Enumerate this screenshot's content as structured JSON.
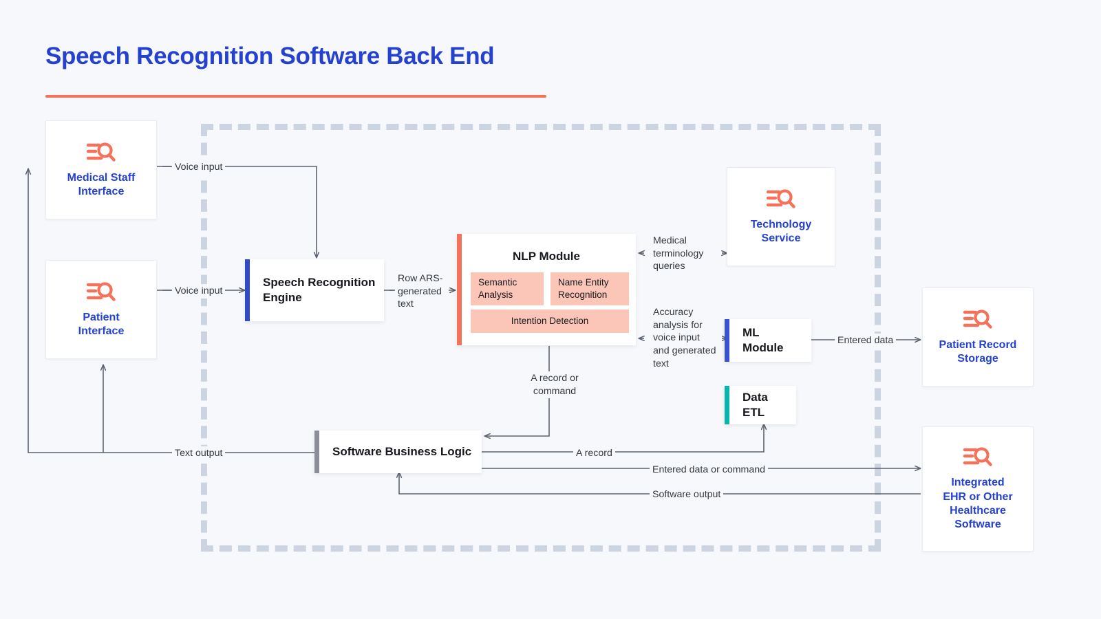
{
  "page": {
    "title": "Speech Recognition Software Back End",
    "accent_rule_color": "#f4715a",
    "title_color": "#2541cf",
    "background": "#f6f8fb",
    "dashed_border_color": "#ccd4e2"
  },
  "nodes": {
    "medical_staff_interface": {
      "label": "Medical Staff\nInterface",
      "icon": "list-search-icon",
      "icon_color": "#f4715a"
    },
    "patient_interface": {
      "label": "Patient\nInterface",
      "icon": "list-search-icon",
      "icon_color": "#f4715a"
    },
    "technology_service": {
      "label": "Technology\nService",
      "icon": "list-search-icon",
      "icon_color": "#f4715a"
    },
    "patient_record_storage": {
      "label": "Patient Record\nStorage",
      "icon": "list-search-icon",
      "icon_color": "#f4715a"
    },
    "integrated_ehr": {
      "label": "Integrated\nEHR or Other\nHealthcare\nSoftware",
      "icon": "list-search-icon",
      "icon_color": "#f4715a"
    },
    "speech_recognition_engine": {
      "label": "Speech Recognition\nEngine",
      "stripe_color": "#2f4bc8"
    },
    "ml_module": {
      "label": "ML Module",
      "stripe_color": "#3a51d4"
    },
    "data_etl": {
      "label": "Data ETL",
      "stripe_color": "#07b5ae"
    },
    "software_business_logic": {
      "label": "Software Business Logic",
      "stripe_color": "#8c8f99"
    },
    "nlp_module": {
      "title": "NLP Module",
      "stripe_color": "#f4715a",
      "sub_bg": "#fbc6b8",
      "submodules": [
        {
          "label": "Semantic\nAnalysis"
        },
        {
          "label": "Name Entity\nRecognition"
        },
        {
          "label": "Intention Detection"
        }
      ]
    }
  },
  "edges": {
    "voice_input_staff": "Voice input",
    "voice_input_patient": "Voice input",
    "row_ars_text": "Row ARS-\ngenerated\ntext",
    "medical_terminology_queries": "Medical\nterminology\nqueries",
    "accuracy_analysis": "Accuracy\nanalysis for\nvoice input\nand generated\ntext",
    "entered_data": "Entered data",
    "record_or_command": "A record or\ncommand",
    "text_output": "Text output",
    "a_record": "A record",
    "entered_data_or_command": "Entered data  or command",
    "software_output": "Software output"
  }
}
